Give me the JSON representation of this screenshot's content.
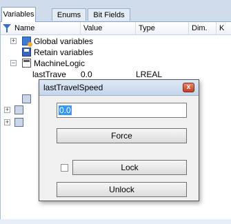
{
  "tabs": [
    {
      "label": "Variables",
      "active": true
    },
    {
      "label": "Enums",
      "active": false
    },
    {
      "label": "Bit Fields",
      "active": false
    }
  ],
  "columns": {
    "name": "Name",
    "value": "Value",
    "type": "Type",
    "dim": "Dim.",
    "kv": "K"
  },
  "tree": {
    "global_label": "Global variables",
    "retain_label": "Retain variables",
    "machine_label": "MachineLogic",
    "var_row": {
      "name": "lastTrave",
      "value": "0.0",
      "type": "LREAL"
    }
  },
  "dialog": {
    "title": "lastTravelSpeed",
    "close_glyph": "x",
    "input_value": "0.0",
    "force_label": "Force",
    "lock_label": "Lock",
    "unlock_label": "Unlock",
    "lock_checked": false
  }
}
